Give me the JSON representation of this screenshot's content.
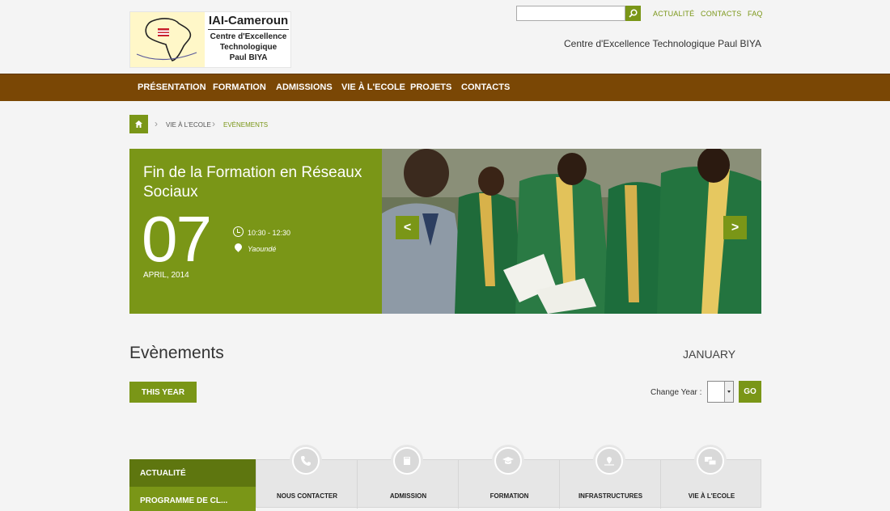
{
  "header": {
    "logo_title": "IAI-Cameroun",
    "logo_lines": [
      "Centre d'Excellence",
      "Technologique",
      "Paul BIYA"
    ],
    "search": {
      "value": "",
      "placeholder": ""
    },
    "top_links": [
      "ACTUALITÉ",
      "CONTACTS",
      "FAQ"
    ],
    "tagline": "Centre d'Excellence Technologique Paul BIYA"
  },
  "nav": {
    "items": [
      "PRÉSENTATION",
      "FORMATION",
      "ADMISSIONS",
      "VIE À L'ECOLE",
      "PROJETS",
      "CONTACTS"
    ]
  },
  "breadcrumb": {
    "items": [
      "VIE À L'ECOLE",
      "EVÈNEMENTS"
    ]
  },
  "event": {
    "title": "Fin de la Formation en Réseaux Sociaux",
    "day": "07",
    "month_year": "APRIL, 2014",
    "time": "10:30 - 12:30",
    "place": "Yaoundé"
  },
  "slider": {
    "prev": "<",
    "next": ">"
  },
  "events_section": {
    "title": "Evènements",
    "month": "JANUARY",
    "this_year_label": "THIS YEAR",
    "change_year_label": "Change Year :",
    "go_label": "GO"
  },
  "bottom": {
    "sidebar": [
      "ACTUALITÉ",
      "PROGRAMME DE CL..."
    ],
    "tiles": [
      {
        "label": "NOUS CONTACTER",
        "icon": "phone-icon"
      },
      {
        "label": "ADMISSION",
        "icon": "book-icon"
      },
      {
        "label": "FORMATION",
        "icon": "graduation-cap-icon"
      },
      {
        "label": "INFRASTRUCTURES",
        "icon": "map-pin-icon"
      },
      {
        "label": "VIE À L'ECOLE",
        "icon": "chat-icon"
      }
    ]
  },
  "colors": {
    "accent_green": "#7a9617",
    "nav_brown": "#7a4705"
  }
}
